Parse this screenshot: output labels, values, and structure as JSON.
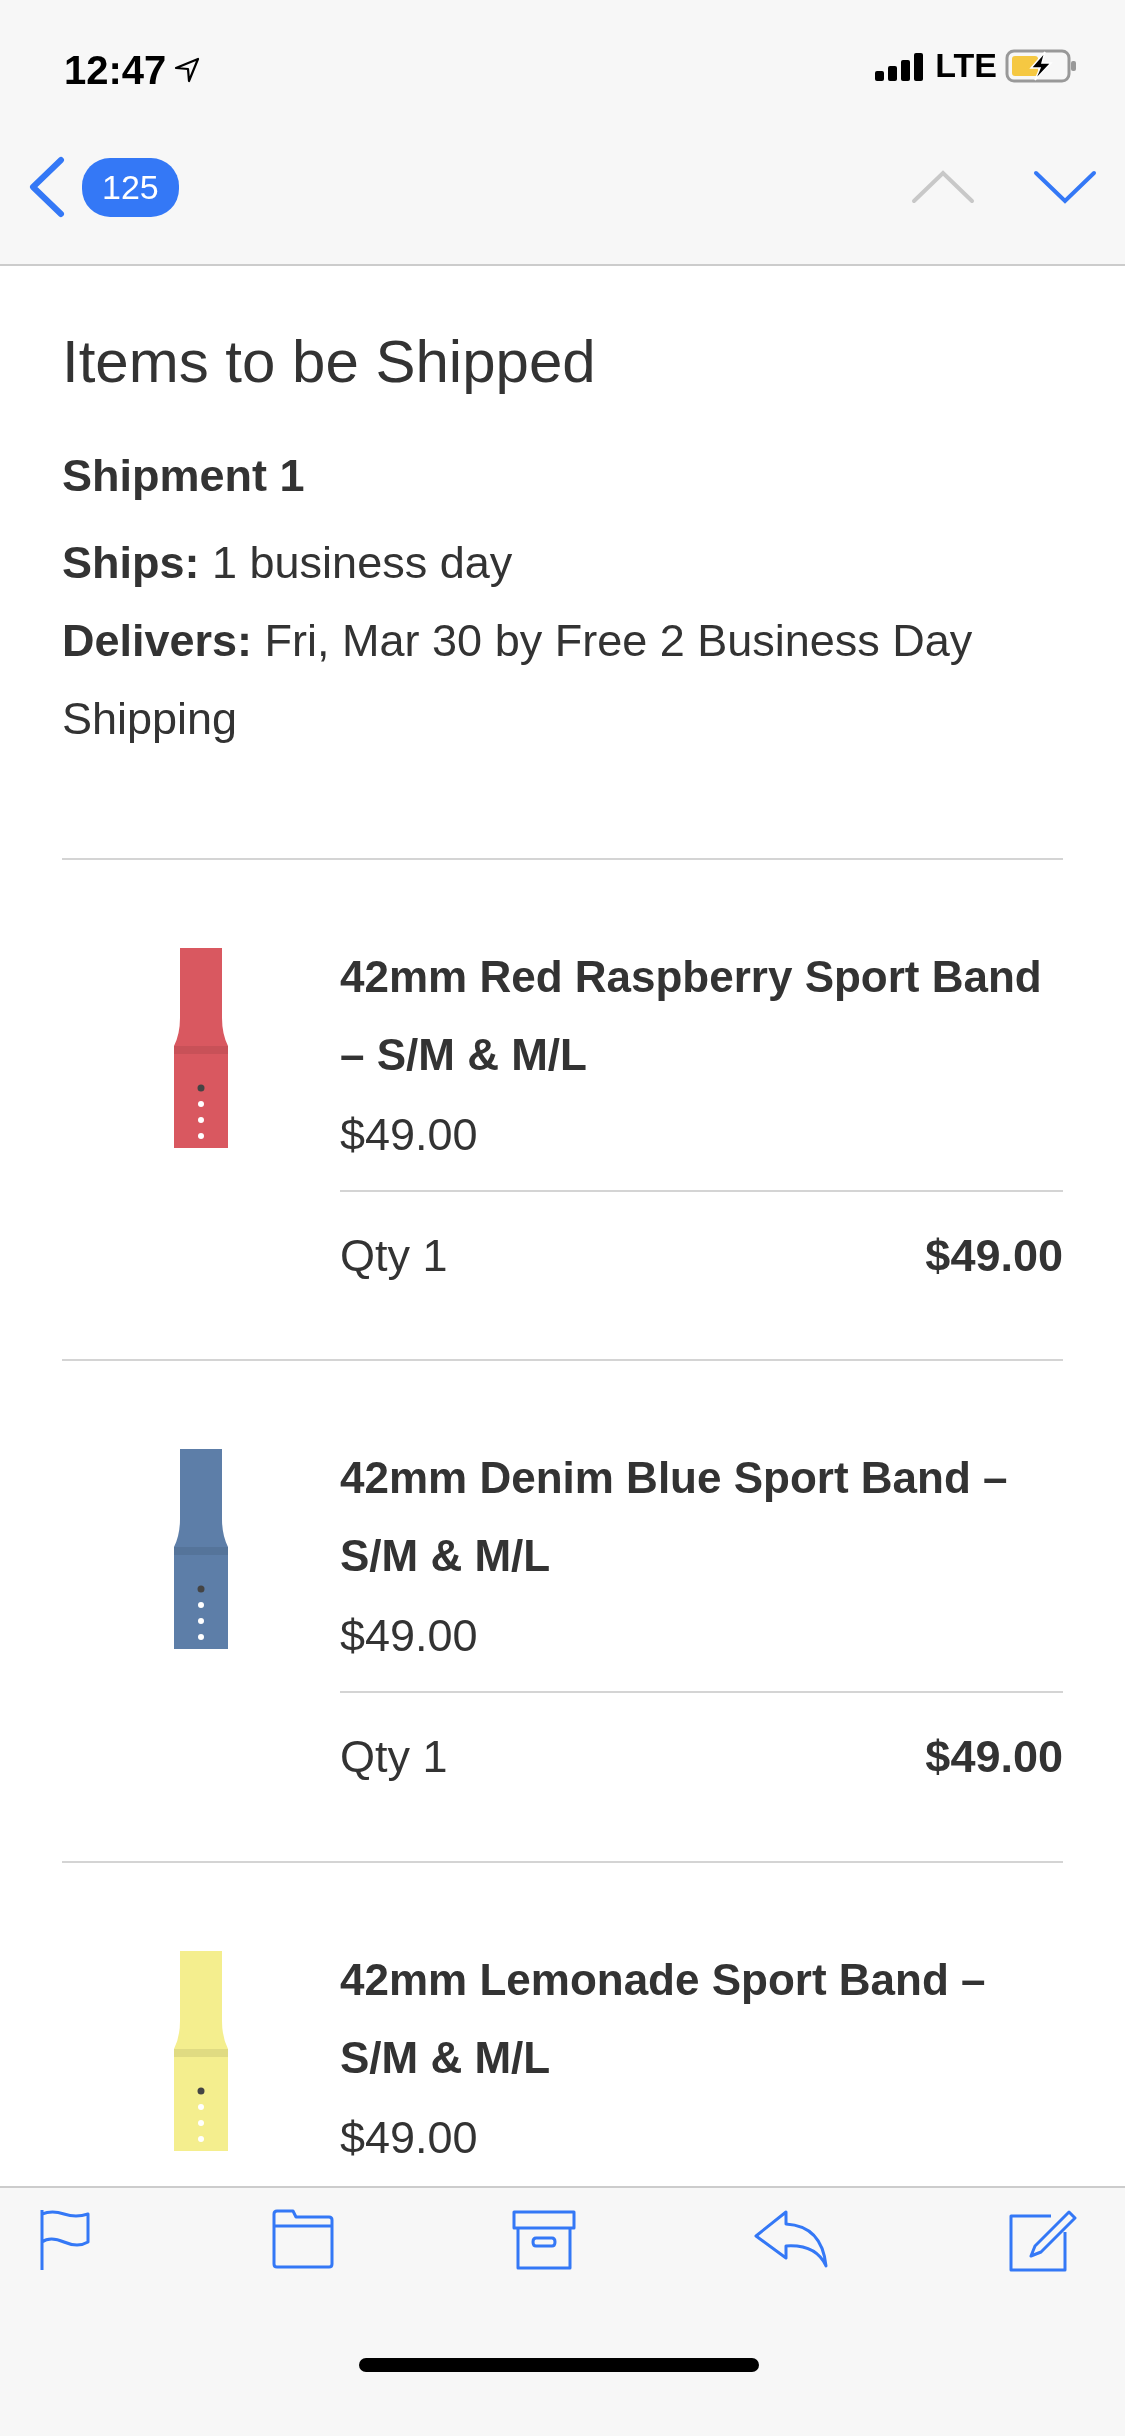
{
  "status_bar": {
    "time": "12:47",
    "network": "LTE"
  },
  "nav_bar": {
    "unread_count": "125",
    "previous": {
      "disabled": true
    },
    "next": {
      "disabled": false
    }
  },
  "heading": "Items to be Shipped",
  "shipment": {
    "title": "Shipment 1",
    "lines": [
      "**Ships:** 1 business day",
      "**Delivers:** Fri, Mar 30 by Free 2 Business Day Shipping"
    ]
  },
  "items": [
    {
      "name": "42mm Red Raspberry Sport Band – S/M & M/L",
      "price": "$49.00",
      "qty": "Qty 1",
      "total": "$49.00",
      "color": "#d95860"
    },
    {
      "name": "42mm Denim Blue Sport Band – S/M & M/L",
      "price": "$49.00",
      "qty": "Qty 1",
      "total": "$49.00",
      "color": "#5d7ea8"
    },
    {
      "name": "42mm Lemonade Sport Band – S/M & M/L",
      "price": "$49.00",
      "color": "#f4ee8e"
    }
  ]
}
